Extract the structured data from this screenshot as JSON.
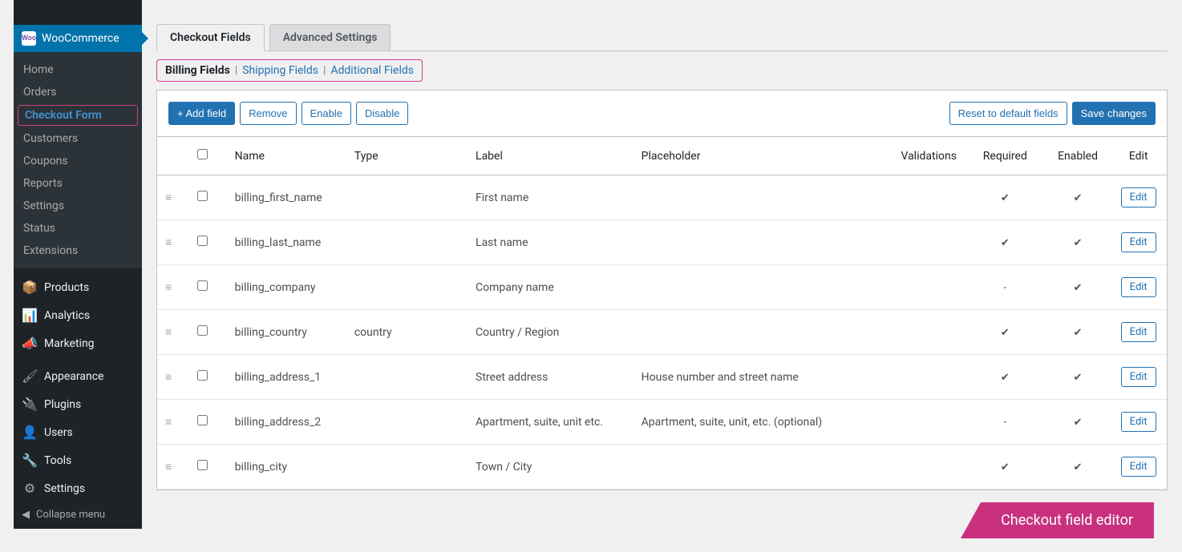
{
  "sidebar": {
    "woocommerce_label": "WooCommerce",
    "wc_logo_text": "Woo",
    "submenu": [
      "Home",
      "Orders",
      "Checkout Form",
      "Customers",
      "Coupons",
      "Reports",
      "Settings",
      "Status",
      "Extensions"
    ],
    "submenu_current": "Checkout Form",
    "main_menu": [
      {
        "icon": "box",
        "label": "Products"
      },
      {
        "icon": "bars",
        "label": "Analytics"
      },
      {
        "icon": "mega",
        "label": "Marketing"
      },
      {
        "sep": true
      },
      {
        "icon": "brush",
        "label": "Appearance"
      },
      {
        "icon": "plug",
        "label": "Plugins"
      },
      {
        "icon": "user",
        "label": "Users"
      },
      {
        "icon": "wrench",
        "label": "Tools"
      },
      {
        "icon": "sliders",
        "label": "Settings"
      }
    ],
    "collapse_label": "Collapse menu"
  },
  "tabs": [
    {
      "label": "Checkout Fields",
      "active": true
    },
    {
      "label": "Advanced Settings",
      "active": false
    }
  ],
  "subtabs": [
    {
      "label": "Billing Fields",
      "active": true
    },
    {
      "label": "Shipping Fields",
      "active": false
    },
    {
      "label": "Additional Fields",
      "active": false
    }
  ],
  "toolbar": {
    "add": "+ Add field",
    "remove": "Remove",
    "enable": "Enable",
    "disable": "Disable",
    "reset": "Reset to default fields",
    "save": "Save changes"
  },
  "columns": [
    "Name",
    "Type",
    "Label",
    "Placeholder",
    "Validations",
    "Required",
    "Enabled",
    "Edit"
  ],
  "edit_label": "Edit",
  "rows": [
    {
      "name": "billing_first_name",
      "type": "",
      "label": "First name",
      "placeholder": "",
      "validations": "",
      "required": true,
      "enabled": true
    },
    {
      "name": "billing_last_name",
      "type": "",
      "label": "Last name",
      "placeholder": "",
      "validations": "",
      "required": true,
      "enabled": true
    },
    {
      "name": "billing_company",
      "type": "",
      "label": "Company name",
      "placeholder": "",
      "validations": "",
      "required": false,
      "enabled": true
    },
    {
      "name": "billing_country",
      "type": "country",
      "label": "Country / Region",
      "placeholder": "",
      "validations": "",
      "required": true,
      "enabled": true
    },
    {
      "name": "billing_address_1",
      "type": "",
      "label": "Street address",
      "placeholder": "House number and street name",
      "validations": "",
      "required": true,
      "enabled": true
    },
    {
      "name": "billing_address_2",
      "type": "",
      "label": "Apartment, suite, unit etc.",
      "placeholder": "Apartment, suite, unit, etc. (optional)",
      "validations": "",
      "required": false,
      "enabled": true
    },
    {
      "name": "billing_city",
      "type": "",
      "label": "Town / City",
      "placeholder": "",
      "validations": "",
      "required": true,
      "enabled": true
    }
  ],
  "ribbon": "Checkout field editor"
}
